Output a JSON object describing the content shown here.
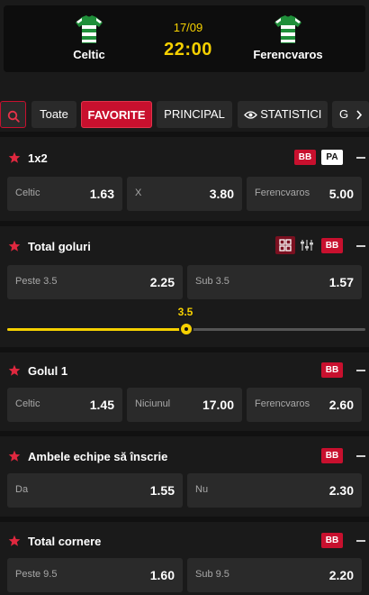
{
  "match": {
    "home": "Celtic",
    "away": "Ferencvaros",
    "date": "17/09",
    "time": "22:00",
    "colors": {
      "accent": "#c8102e",
      "time": "#f5d000"
    }
  },
  "tabs": {
    "all": "Toate",
    "favorites": "FAVORITE",
    "main": "PRINCIPAL",
    "stats": "STATISTICI",
    "more": "G",
    "icons": [
      "search-icon",
      "eye-icon",
      "chevron-right-icon"
    ]
  },
  "markets": {
    "m1x2": {
      "title": "1x2",
      "badges": [
        "BB",
        "PA"
      ],
      "odds": [
        {
          "label": "Celtic",
          "value": "1.63"
        },
        {
          "label": "X",
          "value": "3.80"
        },
        {
          "label": "Ferencvaros",
          "value": "5.00"
        }
      ]
    },
    "total_goals": {
      "title": "Total goluri",
      "badges": [
        "BB"
      ],
      "odds": [
        {
          "label": "Peste 3.5",
          "value": "2.25"
        },
        {
          "label": "Sub 3.5",
          "value": "1.57"
        }
      ],
      "slider_value": "3.5",
      "slider_fraction": 0.5
    },
    "first_goal": {
      "title": "Golul 1",
      "badges": [
        "BB"
      ],
      "odds": [
        {
          "label": "Celtic",
          "value": "1.45"
        },
        {
          "label": "Niciunul",
          "value": "17.00"
        },
        {
          "label": "Ferencvaros",
          "value": "2.60"
        }
      ]
    },
    "btts": {
      "title": "Ambele echipe să înscrie",
      "badges": [
        "BB"
      ],
      "odds": [
        {
          "label": "Da",
          "value": "1.55"
        },
        {
          "label": "Nu",
          "value": "2.30"
        }
      ]
    },
    "corners": {
      "title": "Total cornere",
      "badges": [
        "BB"
      ],
      "odds": [
        {
          "label": "Peste 9.5",
          "value": "1.60"
        },
        {
          "label": "Sub 9.5",
          "value": "2.20"
        }
      ]
    }
  }
}
